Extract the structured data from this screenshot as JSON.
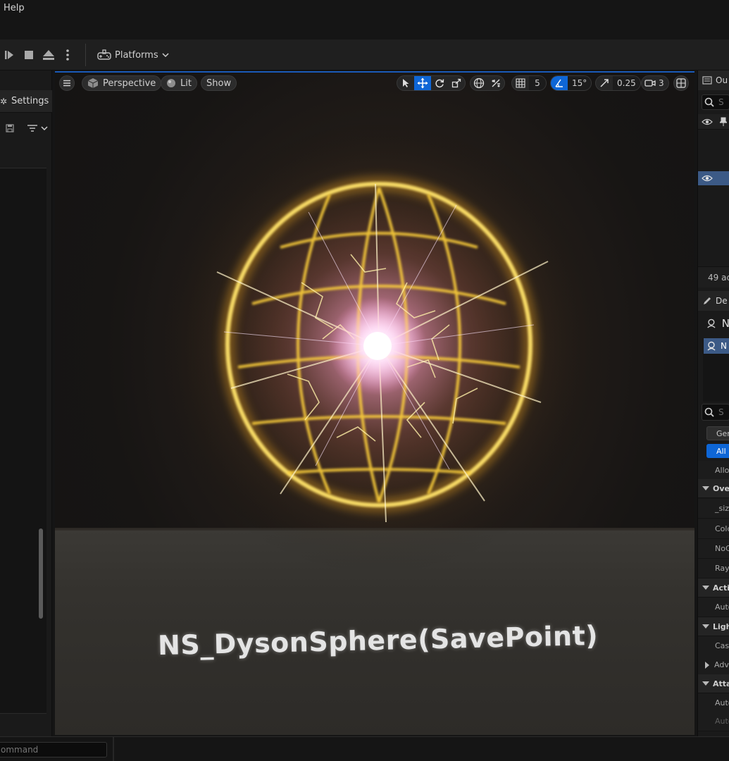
{
  "menu": {
    "help_label": "Help"
  },
  "toolbar": {
    "platforms_label": "Platforms"
  },
  "left_panel": {
    "settings_tab_label": "Settings"
  },
  "viewport": {
    "perspective_label": "Perspective",
    "lit_label": "Lit",
    "show_label": "Show",
    "grid_snap_value": "5",
    "rotation_snap_value": "15°",
    "scale_snap_value": "0.25",
    "camera_speed_value": "3",
    "actor_label_text": "NS_DysonSphere(SavePoint)"
  },
  "outliner": {
    "tab_label": "Ou",
    "search_placeholder": "S",
    "actor_count": "49 ac"
  },
  "details": {
    "tab_label": "De",
    "actor_name": "N",
    "component_name": "N",
    "search_placeholder": "S",
    "filter_general": "Gen",
    "filter_all": "All",
    "rows": [
      {
        "type": "row",
        "label": "Allov"
      },
      {
        "type": "category",
        "label": "Ove",
        "expanded": true
      },
      {
        "type": "row",
        "label": "_siz"
      },
      {
        "type": "row",
        "label": "Colc"
      },
      {
        "type": "row",
        "label": "NoC"
      },
      {
        "type": "row",
        "label": "Ray"
      },
      {
        "type": "category",
        "label": "Acti",
        "expanded": true
      },
      {
        "type": "row",
        "label": "Auto"
      },
      {
        "type": "category",
        "label": "Ligh",
        "expanded": true
      },
      {
        "type": "row",
        "label": "Cast"
      },
      {
        "type": "row",
        "label": "Adv",
        "collapsed_sub": true
      },
      {
        "type": "category",
        "label": "Atta",
        "expanded": true
      },
      {
        "type": "row",
        "label": "Auto"
      },
      {
        "type": "row",
        "label": "Auto",
        "dim": true
      }
    ]
  },
  "statusbar": {
    "command_placeholder": "ommand"
  },
  "colors": {
    "accent": "#0e66d6",
    "selection": "#3c5a86",
    "glow_gold": "#ffd23a",
    "core_pink": "#ff9ad8"
  }
}
